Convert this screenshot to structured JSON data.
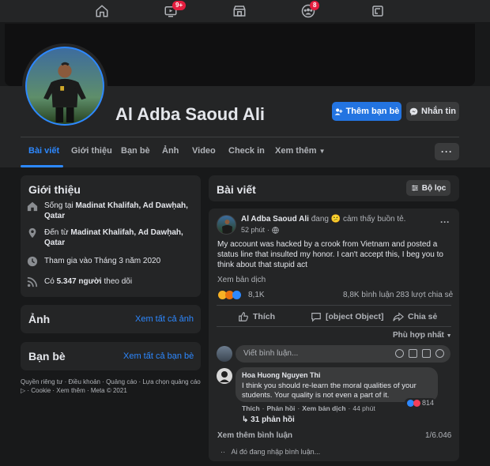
{
  "topnav": {
    "icons": [
      "home-icon",
      "watch-icon",
      "marketplace-icon",
      "groups-icon",
      "gaming-icon"
    ],
    "watch_badge": "9+",
    "groups_badge": "8"
  },
  "profile": {
    "name": "Al Adba Saoud Ali",
    "add_friend_label": "Thêm bạn bè",
    "message_label": "Nhắn tin"
  },
  "tabs": [
    "Bài viết",
    "Giới thiệu",
    "Bạn bè",
    "Ảnh",
    "Video",
    "Check in",
    "Xem thêm"
  ],
  "intro": {
    "title": "Giới thiệu",
    "lives_prefix": "Sống tại ",
    "lives_place": "Madinat Khalifah, Ad Dawḥah, Qatar",
    "from_prefix": "Đến từ ",
    "from_place": "Madinat Khalifah, Ad Dawḥah, Qatar",
    "joined": "Tham gia vào Tháng 3 năm 2020",
    "followers_prefix": "Có ",
    "followers_count": "5.347 người",
    "followers_suffix": " theo dõi"
  },
  "photos": {
    "title": "Ảnh",
    "see_all": "Xem tất cả ảnh"
  },
  "friends": {
    "title": "Bạn bè",
    "see_all": "Xem tất cả bạn bè"
  },
  "footer": "Quyền riêng tư · Điều khoản · Quảng cáo · Lựa chọn quảng cáo ▷ · Cookie · Xem thêm · Meta © 2021",
  "posts": {
    "title": "Bài viết",
    "filter_label": "Bộ lọc",
    "author": "Al Adba Saoud Ali",
    "feeling": "đang 😕 cảm thấy buồn tẻ.",
    "time": "52 phút",
    "text": "My account was hacked by a crook from Vietnam and posted a status line that insulted my honor. I can't accept this, I beg you to think about that stupid act",
    "translate": "Xem bản dịch",
    "reactions": "8,1K",
    "comments_count": "8,8K bình luận",
    "shares_count": "283 lượt chia sẻ",
    "like": "Thích",
    "comment": {
      "author": "Hoa Huong Nguyen Thi",
      "text": "I think you should re-learn the moral qualities of your students. Your quality is not even a part of it.",
      "like": "Thích",
      "reply": "Phản hồi",
      "translate": "Xem bản dịch",
      "time": "44 phút",
      "reactions": "814",
      "replies": "31 phản hồi"
    },
    "share": "Chia sẻ",
    "sort": "Phù hợp nhất",
    "comment_placeholder": "Viết bình luận...",
    "more_comments": "Xem thêm bình luận",
    "comment_progress": "1/6.046",
    "typing": "Ai đó đang nhập bình luận..."
  },
  "colors": {
    "accent": "#2d88ff",
    "background": "#18191a",
    "card": "#242526",
    "badge": "#e41e3f"
  }
}
